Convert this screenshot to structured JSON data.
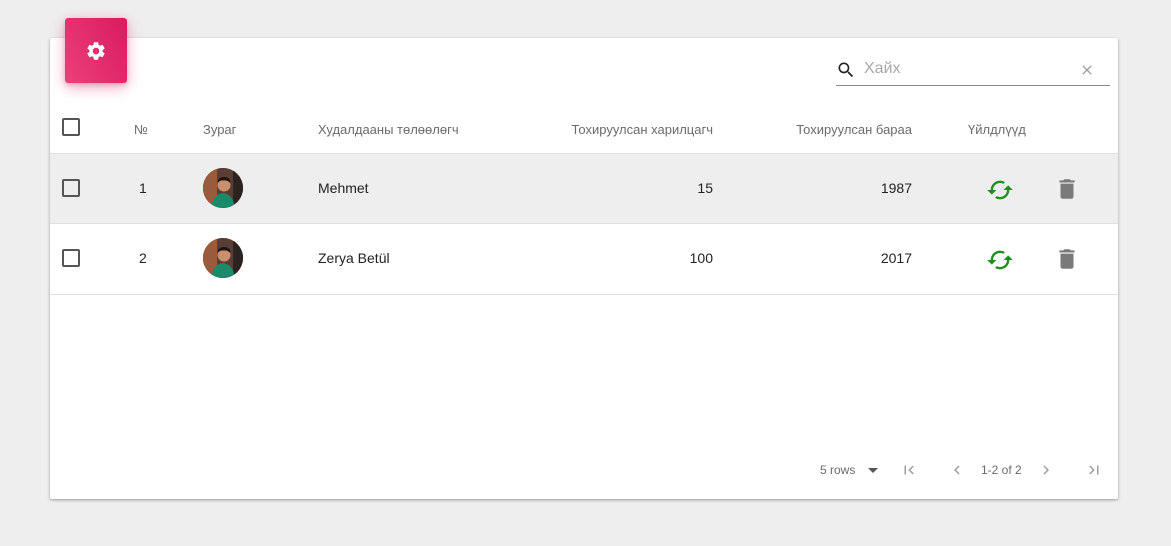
{
  "search": {
    "placeholder": "Хайх",
    "value": ""
  },
  "columns": {
    "number": "№",
    "image": "Зураг",
    "seller": "Худалдааны төлөөлөгч",
    "assigned_customers": "Тохируулсан харилцагч",
    "assigned_products": "Тохируулсан бараа",
    "actions": "Үйлдлүүд"
  },
  "rows": [
    {
      "number": "1",
      "seller": "Mehmet",
      "assigned_customers": "15",
      "assigned_products": "1987"
    },
    {
      "number": "2",
      "seller": "Zerya Betül",
      "assigned_customers": "100",
      "assigned_products": "2017"
    }
  ],
  "pagination": {
    "rows_per_page": "5 rows",
    "range": "1-2 of 2"
  },
  "colors": {
    "accent": "#e91e63",
    "sync": "#1e8e1e",
    "delete": "#7a7a7a"
  },
  "icons": [
    "gear-icon",
    "search-icon",
    "close-icon",
    "sync-icon",
    "trash-icon",
    "first-page-icon",
    "prev-page-icon",
    "next-page-icon",
    "last-page-icon"
  ]
}
